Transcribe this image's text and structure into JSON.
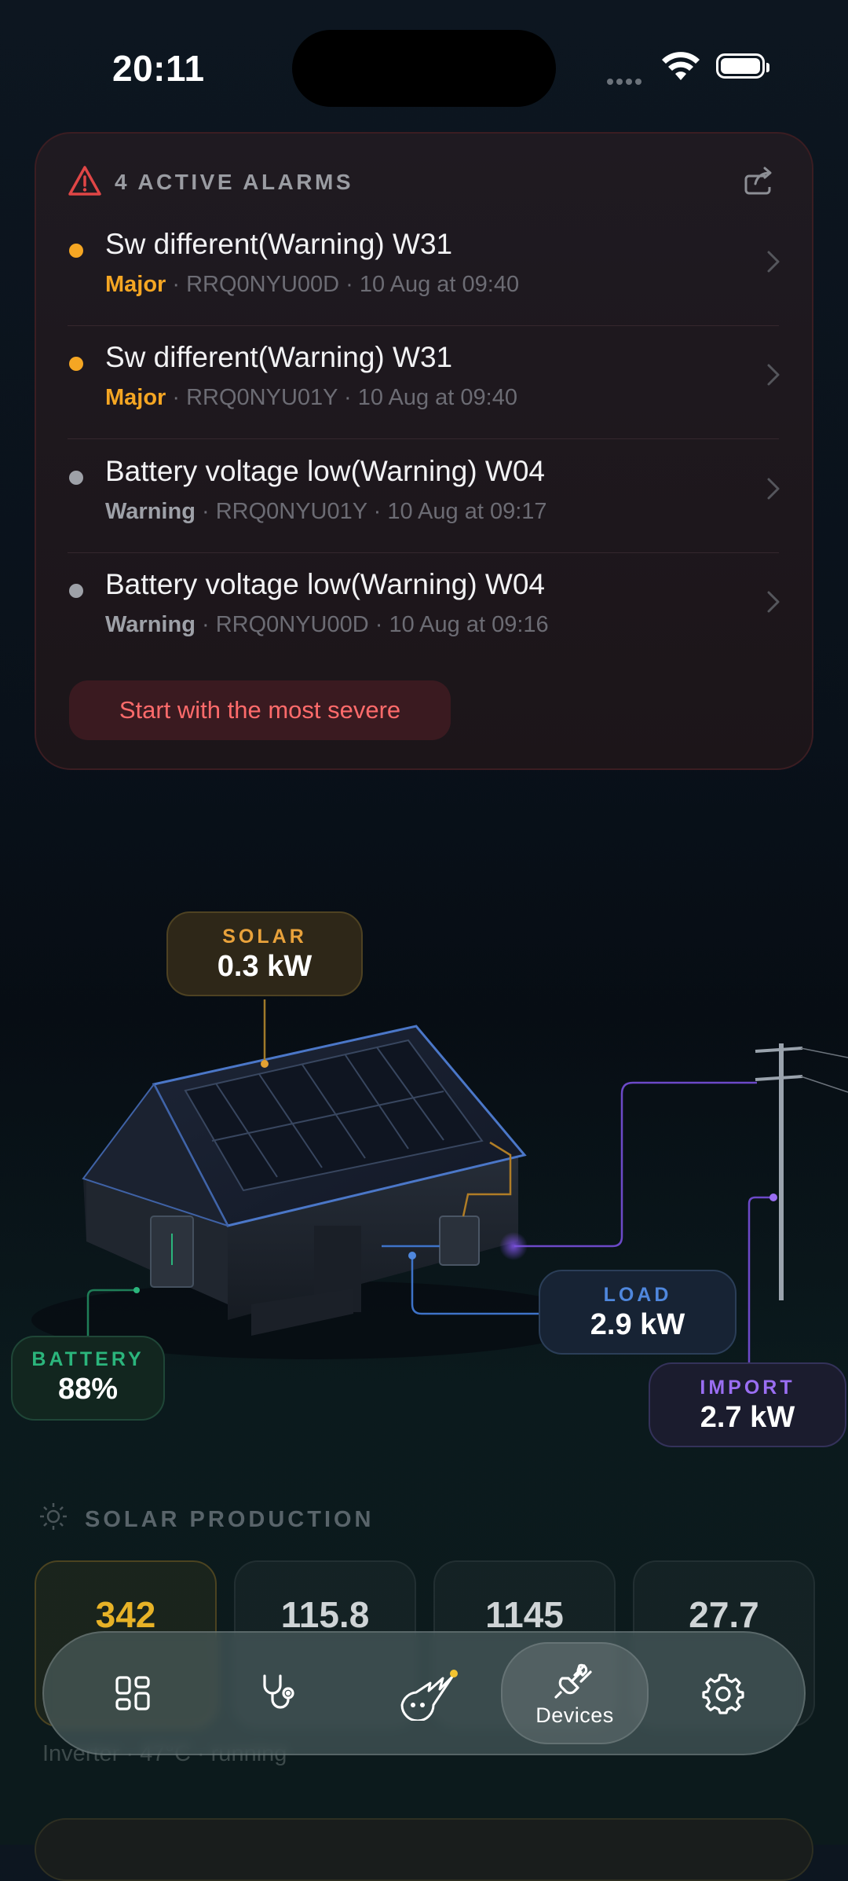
{
  "status_bar": {
    "time": "20:11"
  },
  "alarms": {
    "title": "4 ACTIVE ALARMS",
    "items": [
      {
        "title": "Sw different(Warning) W31",
        "severity": "Major",
        "severity_color": "#f5a623",
        "dot_color": "#f5a623",
        "details": " · RRQ0NYU00D · 10 Aug at 09:40"
      },
      {
        "title": "Sw different(Warning) W31",
        "severity": "Major",
        "severity_color": "#f5a623",
        "dot_color": "#f5a623",
        "details": " · RRQ0NYU01Y · 10 Aug at 09:40"
      },
      {
        "title": "Battery voltage low(Warning) W04",
        "severity": "Warning",
        "severity_color": "#9ea1a8",
        "dot_color": "#9ea1a8",
        "details": " · RRQ0NYU01Y · 10 Aug at 09:17"
      },
      {
        "title": "Battery voltage low(Warning) W04",
        "severity": "Warning",
        "severity_color": "#9ea1a8",
        "dot_color": "#9ea1a8",
        "details": " · RRQ0NYU00D · 10 Aug at 09:16"
      }
    ],
    "action_label": "Start with the most severe"
  },
  "energy_flow": {
    "solar": {
      "label": "SOLAR",
      "value": "0.3 kW",
      "color": "#e9a23b"
    },
    "load": {
      "label": "LOAD",
      "value": "2.9 kW",
      "color": "#4f87dd"
    },
    "import": {
      "label": "IMPORT",
      "value": "2.7 kW",
      "color": "#9a6ef2"
    },
    "battery": {
      "label": "BATTERY",
      "value": "88%",
      "color": "#2bb57c"
    }
  },
  "solar_production": {
    "title": "SOLAR PRODUCTION",
    "stats": [
      "342",
      "115.8",
      "1145",
      "27.7"
    ],
    "footer": "Inverter · 47°C · running"
  },
  "tab_bar": {
    "tabs": [
      {
        "name": "dashboard",
        "icon": "grid-icon"
      },
      {
        "name": "diagnostics",
        "icon": "stethoscope-icon"
      },
      {
        "name": "assistant",
        "icon": "comet-mascot-icon"
      },
      {
        "name": "devices",
        "icon": "plug-icon",
        "label": "Devices",
        "selected": true
      },
      {
        "name": "settings",
        "icon": "gear-icon"
      }
    ]
  }
}
